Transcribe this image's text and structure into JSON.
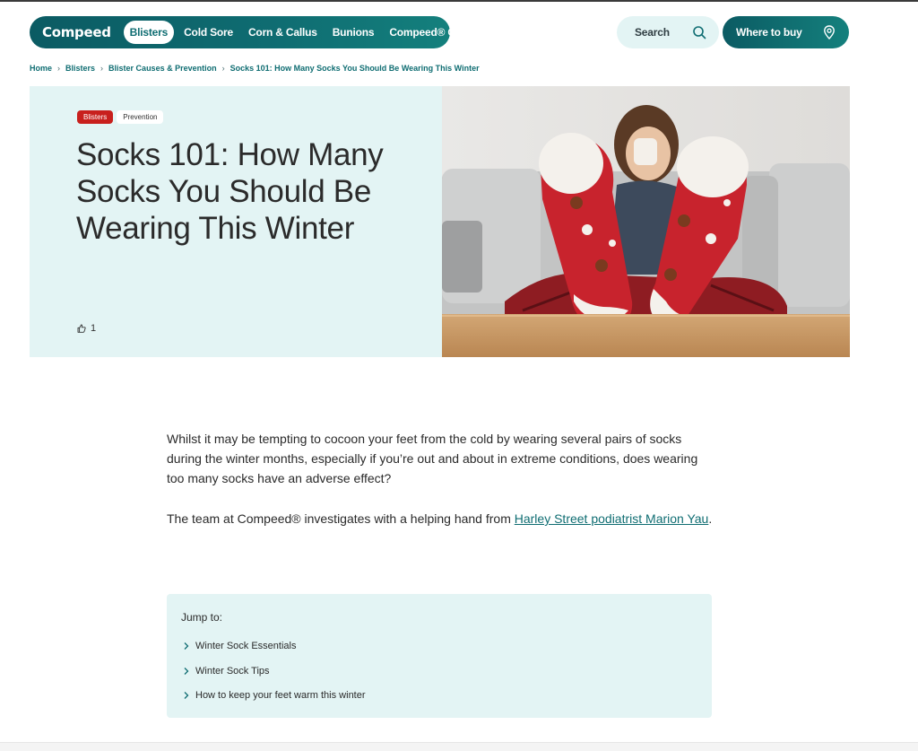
{
  "nav": {
    "logo": "Compeed",
    "items": [
      {
        "label": "Blisters",
        "active": true
      },
      {
        "label": "Cold Sore"
      },
      {
        "label": "Corn & Callus"
      },
      {
        "label": "Bunions"
      },
      {
        "label": "Compeed® Care"
      }
    ],
    "search_label": "Search",
    "where_to_buy_label": "Where to buy"
  },
  "breadcrumb": [
    "Home",
    "Blisters",
    "Blister Causes & Prevention",
    "Socks 101: How Many Socks You Should Be Wearing This Winter"
  ],
  "hero": {
    "tags": [
      "Blisters",
      "Prevention"
    ],
    "title": "Socks 101: How Many Socks You Should Be Wearing This Winter",
    "likes": "1"
  },
  "article": {
    "intro": "Whilst it may be tempting to cocoon your feet from the cold by wearing several pairs of socks during the winter months, especially if you’re out and about in extreme conditions, does wearing too many socks have an adverse effect?",
    "team_prefix": "The team at Compeed® investigates with a helping hand from ",
    "team_link": "Harley Street podiatrist Marion Yau",
    "team_suffix": "."
  },
  "jump_to": {
    "title": "Jump to:",
    "items": [
      "Winter Sock Essentials",
      "Winter Sock Tips",
      "How to keep your feet warm this winter"
    ]
  },
  "colors": {
    "brand_teal": "#0f6d72",
    "hero_bg": "#e3f4f4",
    "tag_red": "#c8201d"
  }
}
